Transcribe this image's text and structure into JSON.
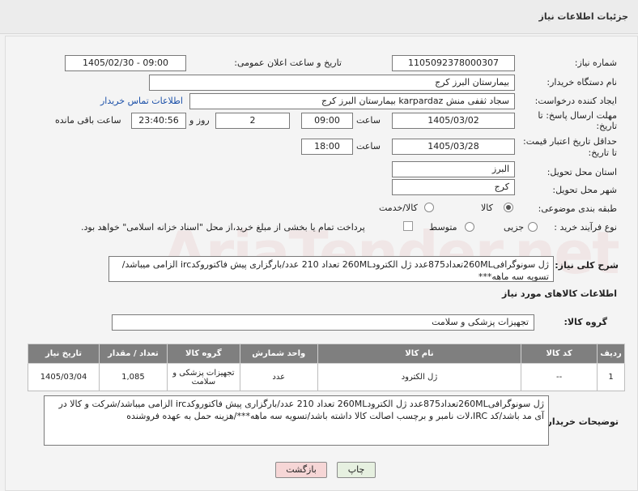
{
  "header": {
    "title": "جزئیات اطلاعات نیاز"
  },
  "fields": {
    "need_number": {
      "label": "شماره نیاز:",
      "value": "1105092378000307"
    },
    "announce": {
      "label": "تاریخ و ساعت اعلان عمومی:",
      "value": "1405/02/30 - 09:00"
    },
    "buyer_org": {
      "label": "نام دستگاه خریدار:",
      "value": "بیمارستان البرز کرج"
    },
    "creator": {
      "label": "ایجاد کننده درخواست:",
      "value": "سجاد ثقفی منش karpardaz بیمارستان البرز کرج",
      "contact_link": "اطلاعات تماس خریدار"
    },
    "deadline": {
      "label_line1": "مهلت ارسال پاسخ: تا",
      "label_line2": "تاریخ:",
      "date": "1405/03/02",
      "time_label": "ساعت",
      "time": "09:00",
      "days": "2",
      "days_label": "روز و",
      "remaining": "23:40:56",
      "remaining_label": "ساعت باقی مانده"
    },
    "price_validity": {
      "label_line1": "حداقل تاریخ اعتبار قیمت:",
      "label_line2": "تا تاریخ:",
      "date": "1405/03/28",
      "time_label": "ساعت",
      "time": "18:00"
    },
    "province": {
      "label": "استان محل تحویل:",
      "value": "البرز"
    },
    "city": {
      "label": "شهر محل تحویل:",
      "value": "کرج"
    },
    "category": {
      "label": "طبقه بندی موضوعی:",
      "opt_goods": "کالا",
      "opt_goods_service": "کالا/خدمت"
    },
    "process": {
      "label": "نوع فرآیند خرید :",
      "opt_partial": "جزیی",
      "opt_medium": "متوسط",
      "treasury_text": "پرداخت تمام یا بخشی از مبلغ خرید،از محل \"اسناد خزانه اسلامی\" خواهد بود."
    }
  },
  "summary": {
    "label": "شرح کلی نیاز:",
    "text": "ژل سونوگرافی260MLتعداد875عدد ژل الکترود260ML تعداد 210 عدد/بارگزاری پیش فاکتوروکدirc الزامی میباشد/تسویه سه ماهه***"
  },
  "items_section": {
    "title": "اطلاعات کالاهای مورد نیاز"
  },
  "group": {
    "label": "گروه کالا:",
    "value": "تجهیزات پزشکی و سلامت"
  },
  "table": {
    "headers": [
      "ردیف",
      "کد کالا",
      "نام کالا",
      "واحد شمارش",
      "گروه کالا",
      "تعداد / مقدار",
      "تاریخ نیاز"
    ],
    "rows": [
      [
        "1",
        "--",
        "ژل الکترود",
        "عدد",
        "تجهیزات پزشکی و سلامت",
        "1,085",
        "1405/03/04"
      ]
    ]
  },
  "buyer_notes": {
    "label": "توضیحات خریدار:",
    "text": "ژل سونوگرافی260MLتعداد875عدد ژل الکترود260ML تعداد 210 عدد/بارگزاری پیش فاکتوروکدirc الزامی میباشد/شرکت و کالا در آی مد باشد/کد IRC،لات نامبر و برچسب اصالت کالا داشته باشد/تسویه سه ماهه***/هزینه حمل به عهده فروشنده"
  },
  "buttons": {
    "print": "چاپ",
    "back": "بازگشت"
  },
  "watermark": {
    "text": "AriaTender.net"
  },
  "colors": {
    "header_bg": "#7f7f7f",
    "link": "#1a4fa8",
    "back_btn": "#f6d6d6",
    "print_btn": "#e6f0e0"
  }
}
